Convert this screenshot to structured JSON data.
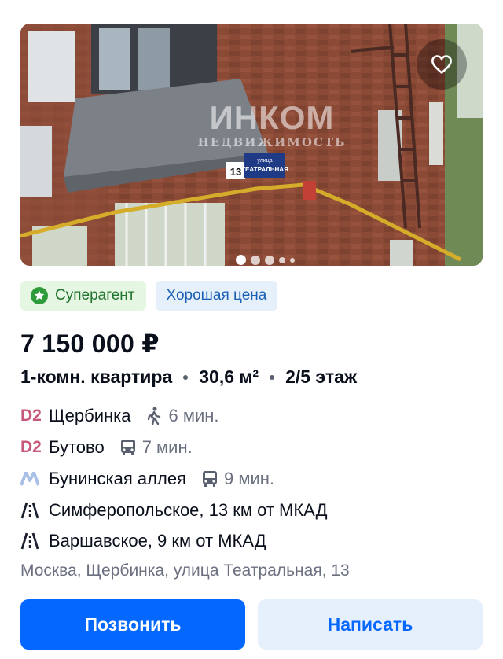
{
  "photo": {
    "alt": "",
    "watermark_main": "ИНКОМ",
    "watermark_sub": "НЕДВИЖИМОСТЬ",
    "sign_number": "13",
    "sign_street_top": "улица",
    "sign_street": "ТЕАТРАЛЬНАЯ",
    "dots": 5,
    "active_dot": 0
  },
  "favorite": {
    "icon": "heart-icon"
  },
  "badges": {
    "superagent": "Суперагент",
    "good_price": "Хорошая цена"
  },
  "listing": {
    "price": "7 150 000 ₽",
    "rooms": "1-комн. квартира",
    "area": "30,6 м²",
    "floor": "2/5 этаж"
  },
  "transport": [
    {
      "line": "D2",
      "line_color": "#c8587a",
      "station": "Щербинка",
      "mode": "walk",
      "time": "6 мин."
    },
    {
      "line": "D2",
      "line_color": "#c8587a",
      "station": "Бутово",
      "mode": "bus",
      "time": "7 мин."
    },
    {
      "line": "M",
      "line_color": "#a9c1e6",
      "station": "Бунинская аллея",
      "mode": "bus",
      "time": "9 мин."
    }
  ],
  "roads": [
    {
      "text": "Симферопольское, 13 км от МКАД"
    },
    {
      "text": "Варшавское, 9 км от МКАД"
    }
  ],
  "address": "Москва, Щербинка, улица Театральная, 13",
  "buttons": {
    "call": "Позвонить",
    "write": "Написать"
  },
  "colors": {
    "primary": "#0468ff",
    "super_bg": "#e5f6e2",
    "price_bg": "#e5f0fb"
  }
}
